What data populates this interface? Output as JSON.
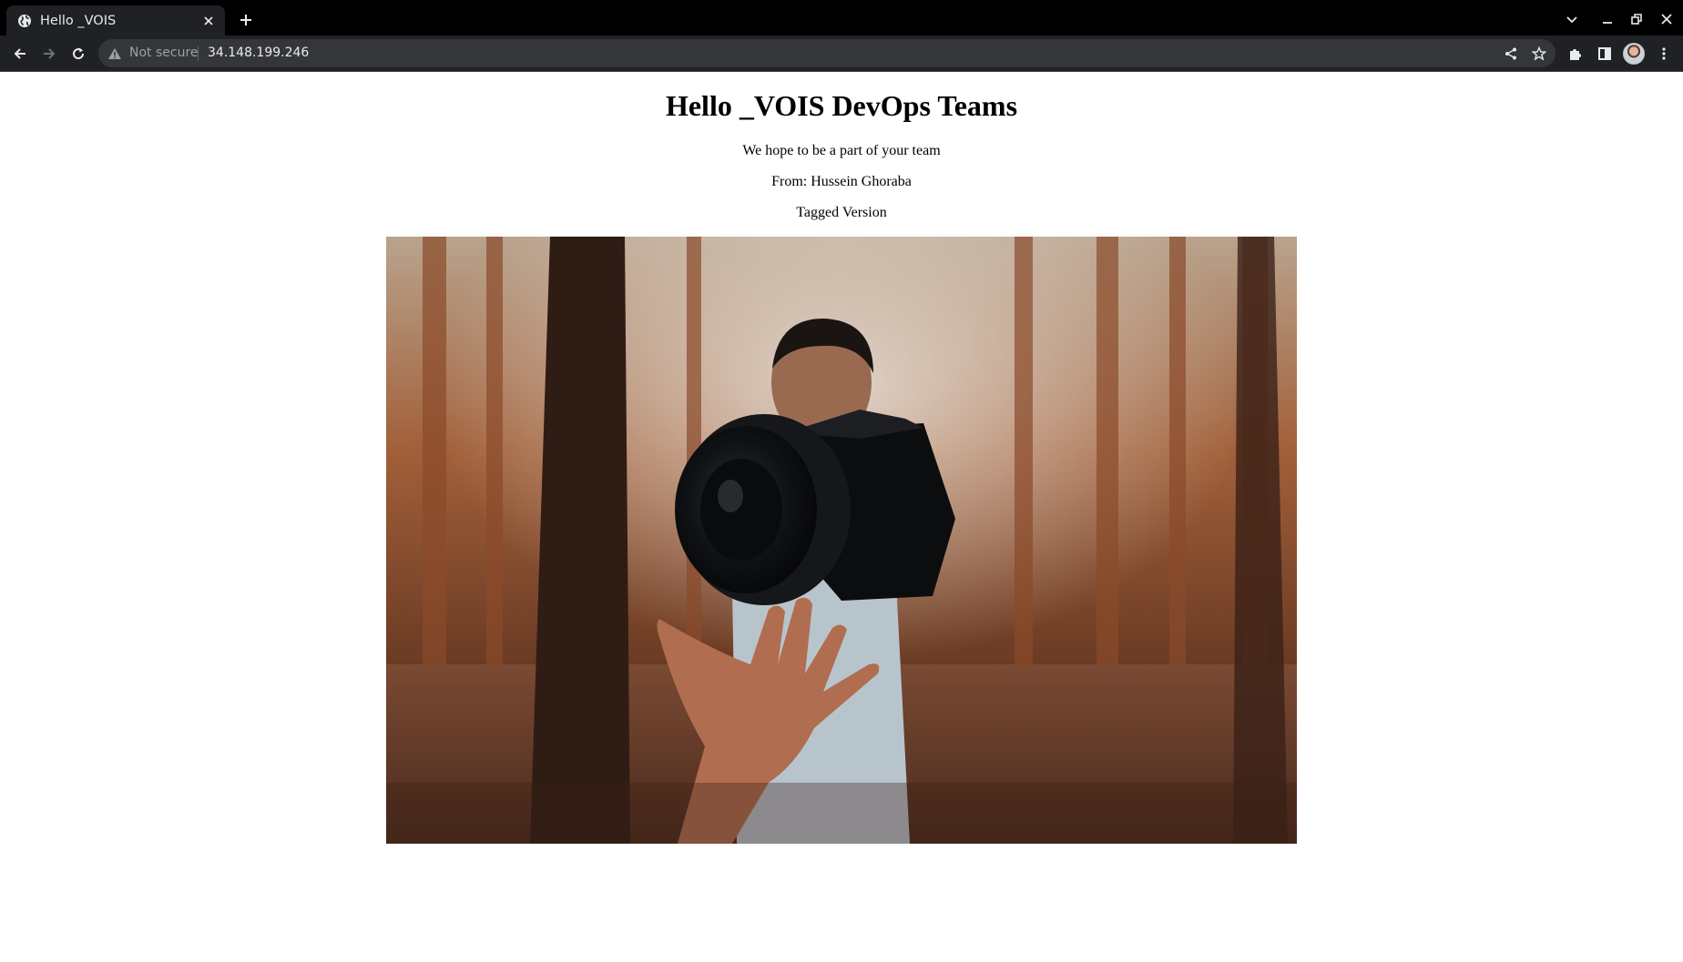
{
  "browser": {
    "tab": {
      "title": "Hello _VOIS"
    },
    "omnibox": {
      "security_label": "Not secure",
      "url": "34.148.199.246"
    }
  },
  "page": {
    "heading": "Hello _VOIS DevOps Teams",
    "message": "We hope to be a part of your team",
    "from": "From: Hussein Ghoraba",
    "version": "Tagged Version"
  },
  "colors": {
    "tabstrip": "#000000",
    "toolbar": "#202124",
    "omnibox": "#35363a",
    "page_bg": "#ffffff"
  },
  "icons": {
    "favicon": "globe-icon",
    "close": "close-icon",
    "new_tab": "plus-icon",
    "warning": "warning-icon",
    "share": "share-icon",
    "bookmark": "star-icon",
    "extensions": "puzzle-icon",
    "side_panel": "side-panel-icon",
    "menu": "kebab-menu-icon"
  }
}
